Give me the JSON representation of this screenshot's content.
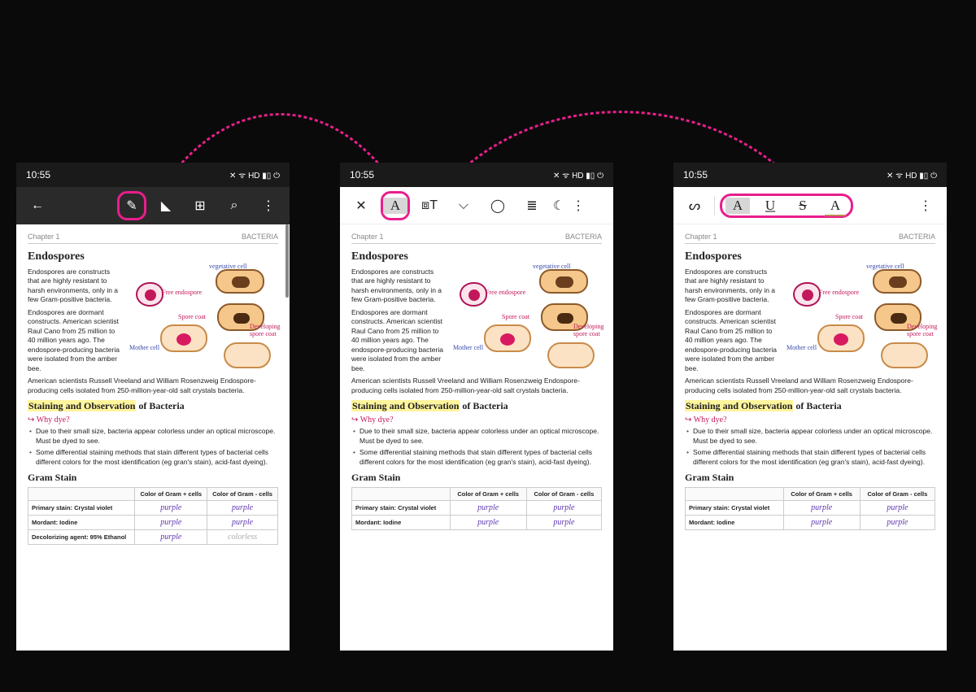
{
  "status": {
    "time": "10:55",
    "icons": "✕ ᯤ HD ▮▯ ⏻"
  },
  "toolbars": {
    "s1": {
      "type": "dark",
      "back": "←",
      "pen": "✎",
      "triangle": "◣",
      "grid": "⊞",
      "search": "⌕",
      "more": "⋮"
    },
    "s2": {
      "type": "light",
      "close": "✕",
      "highlightA": "A",
      "textbox": "⧈T",
      "pitchfork": "⌵",
      "lasso": "◯",
      "note": "≣",
      "moon": "☾",
      "more": "⋮"
    },
    "s3": {
      "type": "light",
      "swirl": "ᔕ",
      "hlA": "A",
      "ulU": "U",
      "stS": "S",
      "sqA": "A",
      "more": "⋮"
    }
  },
  "doc": {
    "chapter": "Chapter 1",
    "subject": "BACTERIA",
    "h_endo": "Endospores",
    "p1": "Endospores are constructs that are highly resistant to harsh environments, only in a few Gram-positive bacteria.",
    "p2": "Endospores are dormant constructs. American scientist Raul Cano from 25 million to 40 million years ago. The endospore-producing bacteria were isolated from the amber bee.",
    "p3": "American scientists Russell Vreeland and William Rosenzweig Endospore-producing cells isolated from 250-million-year-old salt crystals bacteria.",
    "h_stain_hl": "Staining and Observation",
    "h_stain_rest": " of Bacteria",
    "why": "Why dye?",
    "b1": "Due to their small size, bacteria appear colorless under an optical microscope. Must be dyed to see.",
    "b2": "Some differential staining methods that stain different types of bacterial cells different colors for the most identification (eg gran's stain), acid-fast dyeing).",
    "h_gram": "Gram Stain",
    "labels": {
      "veg": "vegetative cell",
      "free": "Free endospore",
      "spore": "Spore coat",
      "dev": "Developing spore coat",
      "mother": "Mother cell"
    },
    "table": {
      "cols": [
        "",
        "Color of\nGram + cells",
        "Color of\nGram - cells"
      ],
      "rows": [
        {
          "label": "Primary stain:\nCrystal violet",
          "pos": "purple",
          "neg": "purple"
        },
        {
          "label": "Mordant:\nIodine",
          "pos": "purple",
          "neg": "purple"
        },
        {
          "label": "Decolorizing agent:\n95% Ethanol",
          "pos": "purple",
          "neg": "colorless"
        }
      ]
    }
  }
}
